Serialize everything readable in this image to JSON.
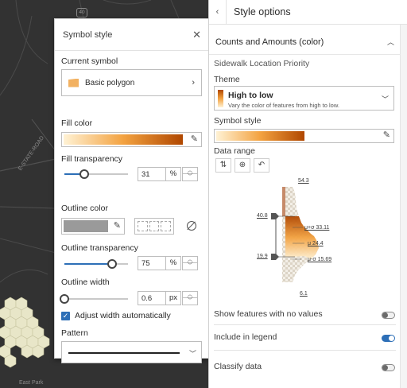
{
  "map": {
    "road_label": "E-STATE-ROAD",
    "park_label": "East Park",
    "route_badge": "40"
  },
  "symbol_panel": {
    "title": "Symbol style",
    "current_symbol_label": "Current symbol",
    "current_symbol_name": "Basic polygon",
    "fill_color_label": "Fill color",
    "fill_transparency_label": "Fill transparency",
    "fill_transparency_value": "31",
    "fill_transparency_unit": "%",
    "fill_transparency_level": 0.31,
    "outline_color_label": "Outline color",
    "outline_transparency_label": "Outline transparency",
    "outline_transparency_value": "75",
    "outline_transparency_unit": "%",
    "outline_transparency_level": 0.75,
    "outline_width_label": "Outline width",
    "outline_width_value": "0.6",
    "outline_width_unit": "px",
    "outline_width_level": 0.0,
    "adjust_width_label": "Adjust width automatically",
    "adjust_width_checked": true,
    "pattern_label": "Pattern",
    "swatch_color": "#f2b161",
    "outline_swatch_color": "#9a9a9a"
  },
  "style_options": {
    "title": "Style options",
    "section_title": "Counts and Amounts (color)",
    "field_name": "Sidewalk Location Priority",
    "theme_label": "Theme",
    "theme_name": "High to low",
    "theme_description": "Vary the color of features from high to low.",
    "symbol_style_label": "Symbol style",
    "data_range_label": "Data range",
    "histogram_labels": {
      "max": "54.3",
      "upper_handle": "40.8",
      "upper_stat": "μ+σ 33.11",
      "mean": "μ 24.4",
      "lower_stat": "μ-σ 15.69",
      "lower_handle": "19.9",
      "min": "6.1"
    },
    "show_no_values_label": "Show features with no values",
    "show_no_values_on": false,
    "include_legend_label": "Include in legend",
    "include_legend_on": true,
    "classify_label": "Classify data",
    "classify_on": false
  },
  "colors": {
    "accent": "#2d6fb7",
    "ramp_light": "#fff2d4",
    "ramp_mid": "#f3a240",
    "ramp_dark": "#b04700"
  }
}
